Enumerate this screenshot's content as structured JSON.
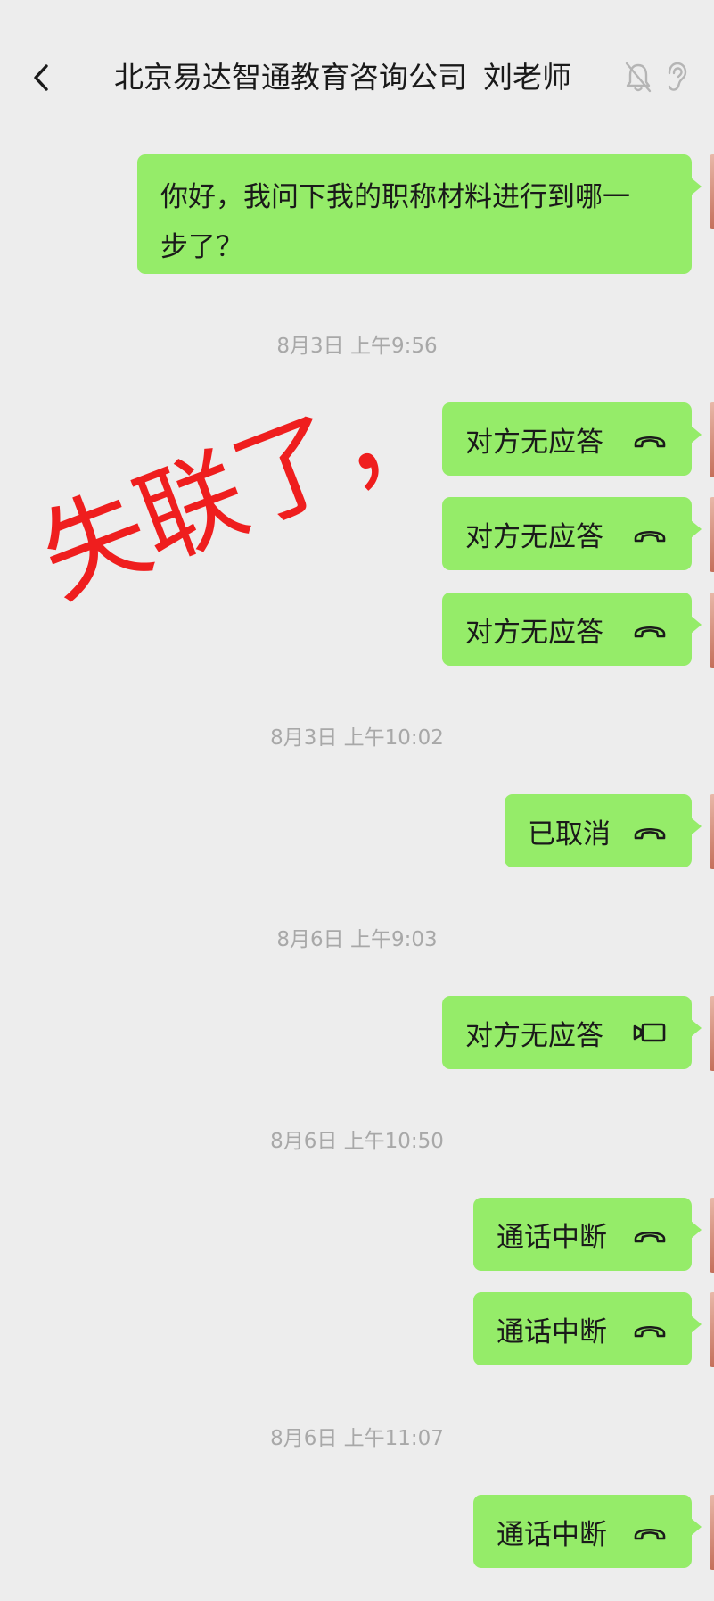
{
  "header": {
    "back_icon": "chevron-left-icon",
    "title": "北京易达智通教育咨询公司",
    "contact": "刘老师",
    "status_icons": [
      "mute-bell-icon",
      "hearing-icon"
    ]
  },
  "chat": {
    "first_message": {
      "line1": "你好，我问下我的职称材料进行到哪一",
      "line2": "步了？"
    },
    "timestamps": [
      "8月3日 上午9:56",
      "8月3日 上午10:02",
      "8月6日 上午9:03",
      "8月6日 上午10:50",
      "8月6日 上午11:07"
    ],
    "calls": [
      {
        "text": "对方无应答",
        "icon": "voice-call-icon"
      },
      {
        "text": "对方无应答",
        "icon": "voice-call-icon"
      },
      {
        "text": "对方无应答",
        "icon": "voice-call-icon"
      },
      {
        "text": "已取消",
        "icon": "voice-call-icon"
      },
      {
        "text": "对方无应答",
        "icon": "video-call-icon"
      },
      {
        "text": "通话中断",
        "icon": "voice-call-icon"
      },
      {
        "text": "通话中断",
        "icon": "voice-call-icon"
      },
      {
        "text": "通话中断",
        "icon": "voice-call-icon"
      }
    ]
  },
  "annotation": {
    "text": "失联了，",
    "color": "#ef1e1e"
  },
  "colors": {
    "background": "#ededed",
    "bubble": "#95ec69",
    "timestamp": "#a8a8a8"
  }
}
